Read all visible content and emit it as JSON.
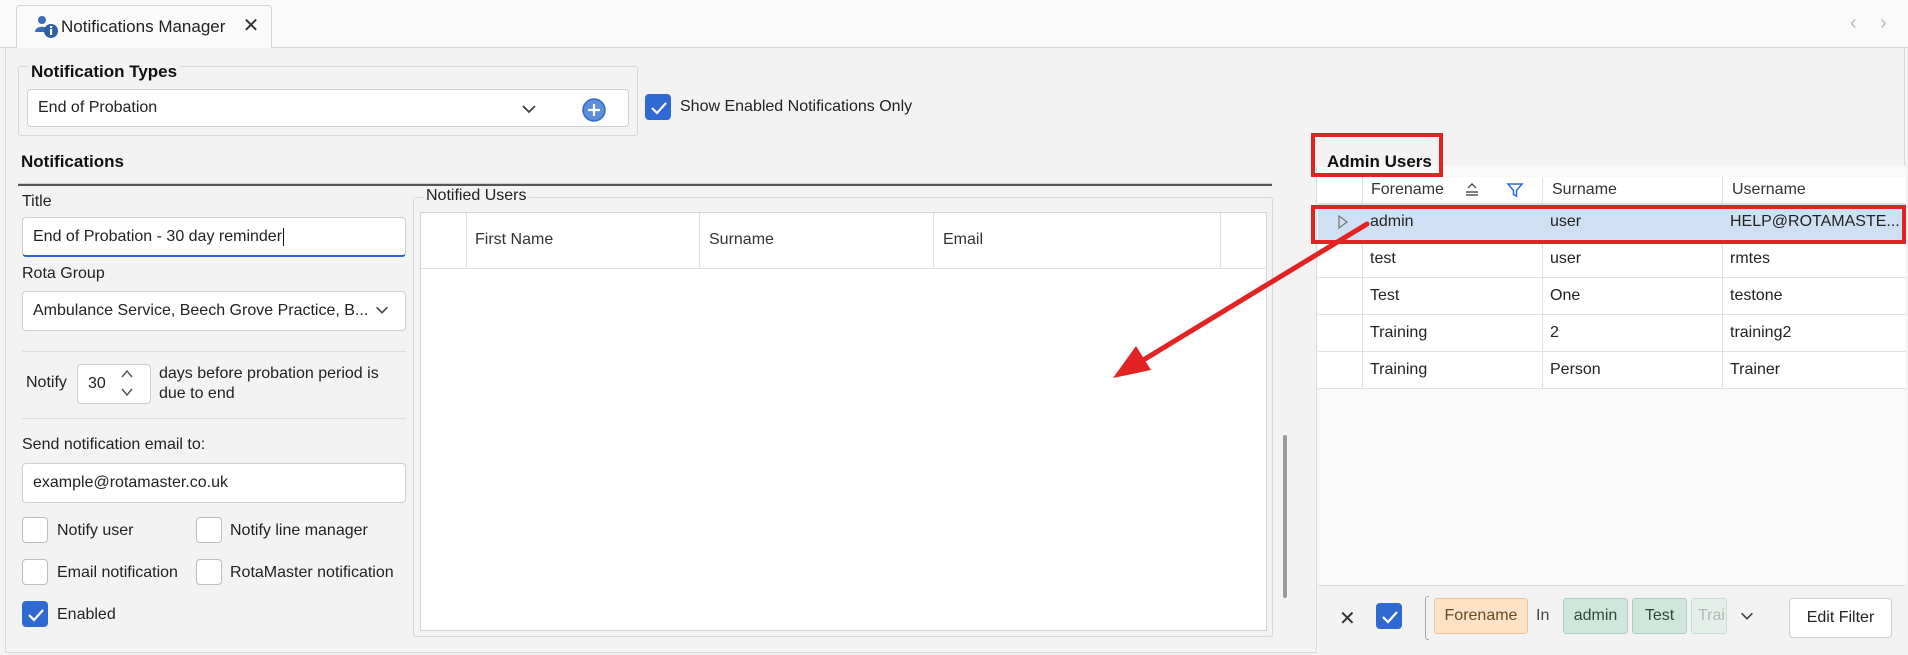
{
  "window": {
    "tab_title": "Notifications Manager",
    "tab_icon": "users-info-icon",
    "close_glyph": "✕",
    "prev_glyph": "‹",
    "next_glyph": "›"
  },
  "notification_types": {
    "group_title": "Notification Types",
    "selected_type": "End of Probation",
    "show_enabled_only_label": "Show Enabled Notifications Only",
    "show_enabled_only_checked": true
  },
  "notifications": {
    "group_title": "Notifications",
    "title_label": "Title",
    "title_value": "End of Probation - 30 day reminder",
    "rota_group_label": "Rota Group",
    "rota_group_value": "Ambulance Service, Beech Grove Practice, B...",
    "notify_label": "Notify",
    "notify_days": "30",
    "notify_suffix_line1": "days before probation period is",
    "notify_suffix_line2": "due to end",
    "send_email_label": "Send notification email to:",
    "email_value": "example@rotamaster.co.uk",
    "checkboxes": {
      "notify_user": {
        "label": "Notify user",
        "checked": false
      },
      "notify_line_manager": {
        "label": "Notify line manager",
        "checked": false
      },
      "email_notification": {
        "label": "Email notification",
        "checked": false
      },
      "rotamaster_notification": {
        "label": "RotaMaster notification",
        "checked": false
      },
      "enabled": {
        "label": "Enabled",
        "checked": true
      }
    }
  },
  "notified_users": {
    "group_title": "Notified Users",
    "columns": [
      "First Name",
      "Surname",
      "Email"
    ]
  },
  "admin_users": {
    "title": "Admin Users",
    "columns": [
      "Forename",
      "Surname",
      "Username"
    ],
    "rows": [
      {
        "forename": "admin",
        "surname": "user",
        "username": "HELP@ROTAMASTE..."
      },
      {
        "forename": "test",
        "surname": "user",
        "username": "rmtes"
      },
      {
        "forename": "Test",
        "surname": "One",
        "username": "testone"
      },
      {
        "forename": "Training",
        "surname": "2",
        "username": "training2"
      },
      {
        "forename": "Training",
        "surname": "Person",
        "username": "Trainer"
      }
    ],
    "selected_row": 0,
    "filter": {
      "field": "Forename",
      "operator": "In",
      "values": [
        "admin",
        "Test",
        "Trai"
      ],
      "edit_filter_label": "Edit Filter",
      "clear_glyph": "✕"
    }
  },
  "colors": {
    "accent": "#2e6ad1",
    "annotation_red": "#e32222",
    "selected_row": "#cfe0f5",
    "chip_field": "#fde3c6",
    "chip_value": "#cfe6dc"
  }
}
